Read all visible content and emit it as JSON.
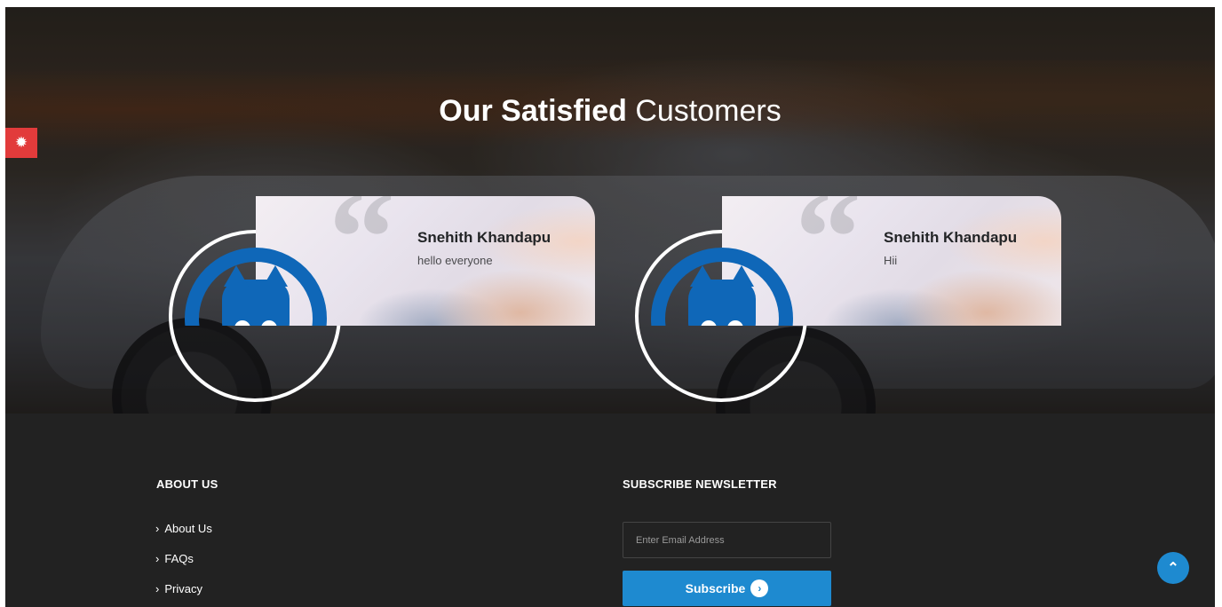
{
  "hero": {
    "title_strong": "Our Satisfied",
    "title_light": "Customers"
  },
  "testimonials": [
    {
      "name": "Snehith Khandapu",
      "text": "hello everyone",
      "avatar_icon": "cat-logo-icon"
    },
    {
      "name": "Snehith Khandapu",
      "text": "Hii",
      "avatar_icon": "cat-logo-icon"
    }
  ],
  "settings": {
    "icon": "gear-icon"
  },
  "footer": {
    "about_heading": "ABOUT US",
    "links": [
      "About Us",
      "FAQs",
      "Privacy"
    ],
    "newsletter_heading": "SUBSCRIBE NEWSLETTER",
    "email_placeholder": "Enter Email Address",
    "subscribe_label": "Subscribe",
    "subscribe_icon": "chevron-right-circle-icon",
    "scroll_top_icon": "chevron-up-icon"
  },
  "colors": {
    "accent_blue": "#1e8ad0",
    "settings_red": "#e23b3b",
    "footer_bg": "#222222",
    "logo_blue": "#0f67b8"
  }
}
